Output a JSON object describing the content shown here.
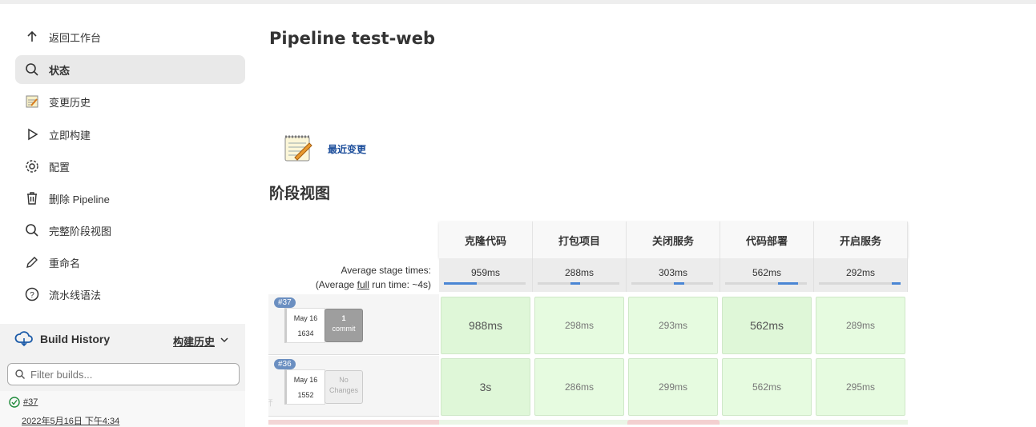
{
  "sidebar": {
    "items": [
      {
        "label": "返回工作台",
        "icon": "arrow-up-icon"
      },
      {
        "label": "状态",
        "icon": "search-icon",
        "active": true
      },
      {
        "label": "变更历史",
        "icon": "notepad-icon"
      },
      {
        "label": "立即构建",
        "icon": "play-icon"
      },
      {
        "label": "配置",
        "icon": "gear-icon"
      },
      {
        "label": "删除 Pipeline",
        "icon": "trash-icon"
      },
      {
        "label": "完整阶段视图",
        "icon": "search-icon"
      },
      {
        "label": "重命名",
        "icon": "pencil-icon"
      },
      {
        "label": "流水线语法",
        "icon": "help-icon"
      }
    ]
  },
  "build_history": {
    "title": "Build History",
    "trend_label": "构建历史",
    "filter_placeholder": "Filter builds...",
    "latest": {
      "number": "#37",
      "date": "2022年5月16日 下午4:34",
      "status": "success"
    }
  },
  "main": {
    "title": "Pipeline test-web",
    "recent_changes": "最近变更",
    "stage_view_title": "阶段视图"
  },
  "stage_view": {
    "stages": [
      "克隆代码",
      "打包项目",
      "关闭服务",
      "代码部署",
      "开启服务"
    ],
    "avg_label_line1": "Average stage times:",
    "avg_label_prefix": "(Average ",
    "avg_label_full": "full",
    "avg_label_suffix": " run time: ~4s)",
    "avg_times": [
      "959ms",
      "288ms",
      "303ms",
      "562ms",
      "292ms"
    ],
    "avg_fill": [
      {
        "start": 0.0,
        "width": 0.4
      },
      {
        "start": 0.4,
        "width": 0.12
      },
      {
        "start": 0.52,
        "width": 0.13
      },
      {
        "start": 0.65,
        "width": 0.24
      },
      {
        "start": 0.89,
        "width": 0.11
      }
    ],
    "builds": [
      {
        "badge": "#37",
        "month_day": "May 16",
        "time": "1634",
        "commit_count": "1",
        "commit_label": "commit",
        "has_commits": true,
        "durations": [
          "988ms",
          "298ms",
          "293ms",
          "562ms",
          "289ms"
        ]
      },
      {
        "badge": "#36",
        "month_day": "May 16",
        "time": "1552",
        "commit_count": "No",
        "commit_label": "Changes",
        "has_commits": false,
        "durations": [
          "3s",
          "286ms",
          "299ms",
          "562ms",
          "295ms"
        ]
      }
    ]
  },
  "colors": {
    "success_cell": "#e6fbe0",
    "failed_row": "#f3d6d6",
    "link": "#1a4c9a",
    "bar_fill": "#4a86d4"
  }
}
